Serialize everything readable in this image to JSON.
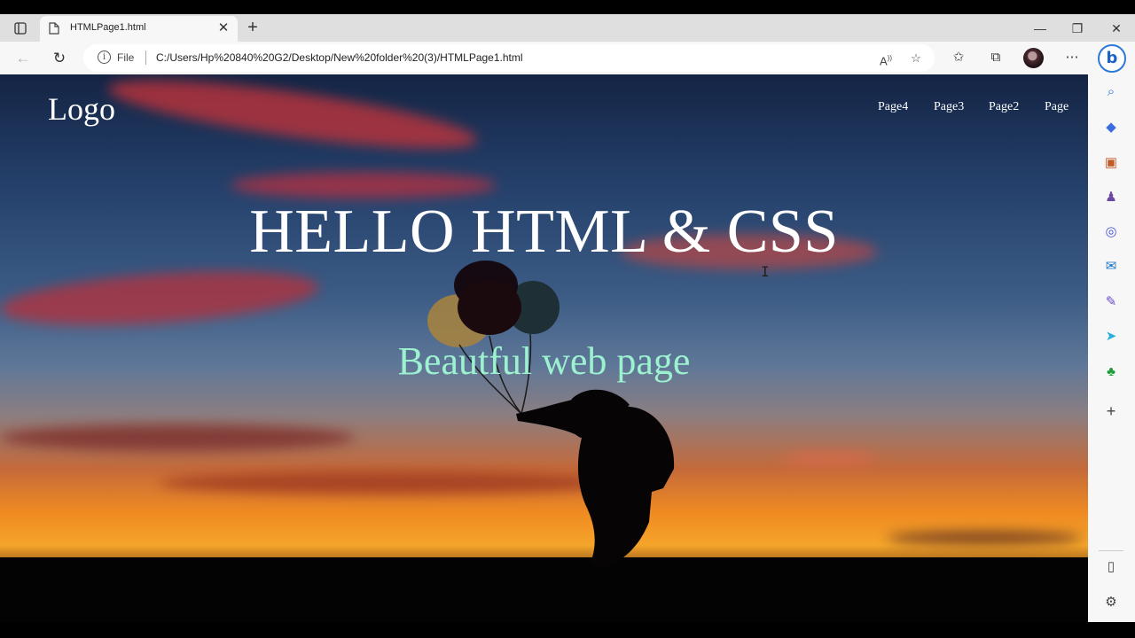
{
  "browser": {
    "tab": {
      "title": "HTMLPage1.html"
    },
    "address": {
      "scheme_label": "File",
      "url": "C:/Users/Hp%20840%20G2/Desktop/New%20folder%20(3)/HTMLPage1.html"
    }
  },
  "page": {
    "logo": "Logo",
    "nav": [
      "Page4",
      "Page3",
      "Page2",
      "Page"
    ],
    "hero_title": "HELLO HTML & CSS",
    "hero_subtitle": "Beautful web page"
  },
  "colors": {
    "subtitle": "#9cf1cf",
    "accent": "#2a79d8"
  }
}
